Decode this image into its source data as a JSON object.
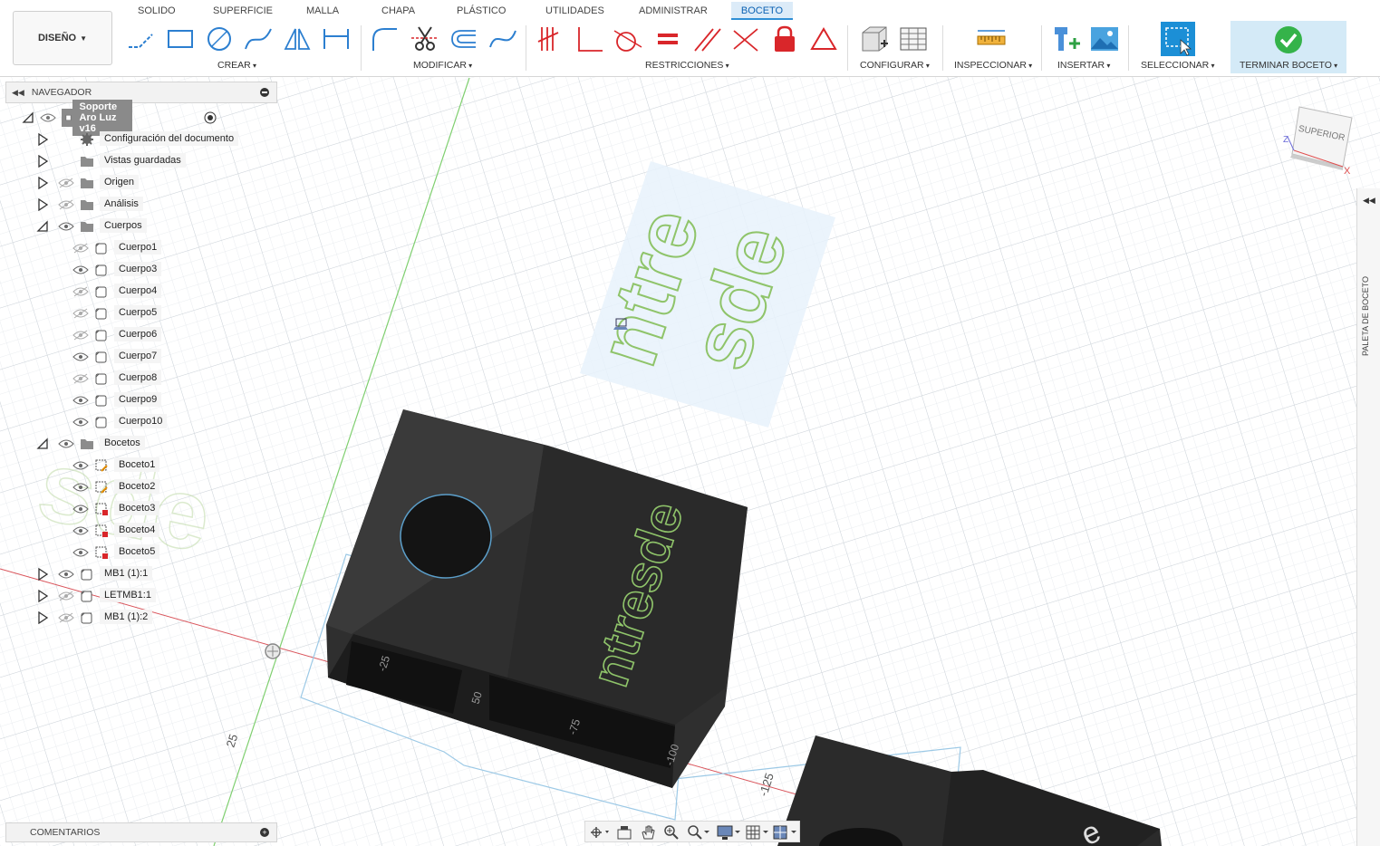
{
  "workspace": {
    "label": "DISEÑO"
  },
  "tabs": [
    "SOLIDO",
    "SUPERFICIE",
    "MALLA",
    "CHAPA",
    "PLÁSTICO",
    "UTILIDADES",
    "ADMINISTRAR",
    "BOCETO"
  ],
  "active_tab": "BOCETO",
  "groups": {
    "crear": "CREAR",
    "modificar": "MODIFICAR",
    "restricciones": "RESTRICCIONES",
    "configurar": "CONFIGURAR",
    "inspeccionar": "INSPECCIONAR",
    "insertar": "INSERTAR",
    "seleccionar": "SELECCIONAR",
    "terminar": "TERMINAR BOCETO"
  },
  "navigator": {
    "title": "NAVEGADOR",
    "root": "Soporte Aro Luz v16",
    "items": [
      {
        "label": "Configuración del documento",
        "icon": "gear-icon",
        "visible": null
      },
      {
        "label": "Vistas guardadas",
        "icon": "folder-icon",
        "visible": null
      },
      {
        "label": "Origen",
        "icon": "folder-icon",
        "visible": false
      },
      {
        "label": "Análisis",
        "icon": "folder-icon",
        "visible": false
      },
      {
        "label": "Cuerpos",
        "icon": "folder-icon",
        "visible": true
      },
      {
        "label": "Cuerpo1",
        "icon": "body-icon",
        "visible": false
      },
      {
        "label": "Cuerpo3",
        "icon": "body-icon",
        "visible": true
      },
      {
        "label": "Cuerpo4",
        "icon": "body-icon",
        "visible": false
      },
      {
        "label": "Cuerpo5",
        "icon": "body-icon",
        "visible": false
      },
      {
        "label": "Cuerpo6",
        "icon": "body-icon",
        "visible": false
      },
      {
        "label": "Cuerpo7",
        "icon": "body-icon",
        "visible": true
      },
      {
        "label": "Cuerpo8",
        "icon": "body-icon",
        "visible": false
      },
      {
        "label": "Cuerpo9",
        "icon": "body-icon",
        "visible": true
      },
      {
        "label": "Cuerpo10",
        "icon": "body-icon",
        "visible": true
      },
      {
        "label": "Bocetos",
        "icon": "folder-icon",
        "visible": true
      },
      {
        "label": "Boceto1",
        "icon": "sketch-icon",
        "visible": true
      },
      {
        "label": "Boceto2",
        "icon": "sketch-icon",
        "visible": true
      },
      {
        "label": "Boceto3",
        "icon": "sketch-lock-icon",
        "visible": true
      },
      {
        "label": "Boceto4",
        "icon": "sketch-lock-icon",
        "visible": true
      },
      {
        "label": "Boceto5",
        "icon": "sketch-lock-icon",
        "visible": true
      },
      {
        "label": "MB1 (1):1",
        "icon": "component-icon",
        "visible": true
      },
      {
        "label": "LETMB1:1",
        "icon": "component-icon",
        "visible": false
      },
      {
        "label": "MB1 (1):2",
        "icon": "component-icon",
        "visible": false
      }
    ]
  },
  "comments": {
    "label": "COMENTARIOS"
  },
  "right_panel": {
    "label": "PALETA DE BOCETO"
  },
  "viewcube": {
    "face": "SUPERIOR",
    "axis_x": "X",
    "axis_z": "Z"
  },
  "canvas": {
    "logo_text_a": "ntre",
    "logo_text_b": "sde",
    "body_text": "ntresde",
    "dims": [
      "25",
      "-25",
      "50",
      "-75",
      "-100",
      "-125"
    ]
  },
  "colors": {
    "accent": "#0696d7",
    "finish_bg": "#d4eaf7",
    "sketch_green": "#8fc46a",
    "constraint_red": "#d9262a"
  }
}
